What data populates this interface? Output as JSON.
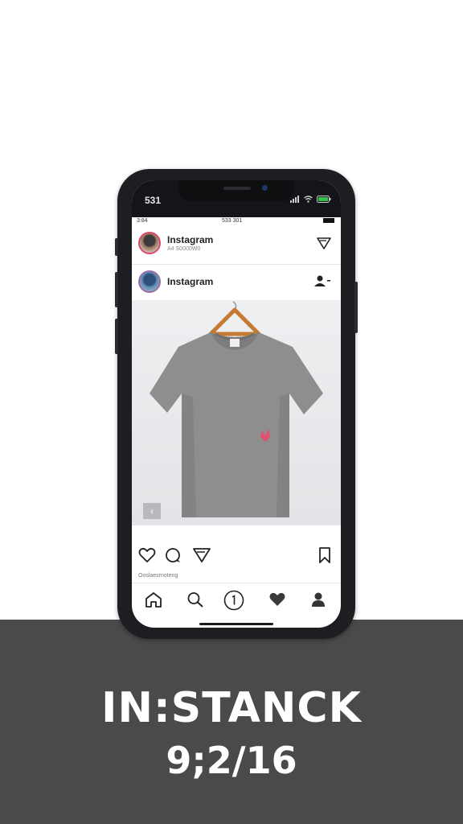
{
  "phone": {
    "status_time": "531",
    "mini_status_left": "3:84",
    "mini_status_mid": "533 301"
  },
  "account_row": {
    "name": "Instagram",
    "sub": "A4 S0000W0"
  },
  "post_header": {
    "name": "Instagram"
  },
  "post": {
    "caption": "Ooslaesrnoteng",
    "carousel_prev": "‹"
  },
  "overlay": {
    "title": "IN:STANCK",
    "subtitle": "9;2/16"
  },
  "icons": {
    "direct": "send-triangle-icon",
    "profile": "person-icon",
    "like": "heart-icon",
    "comment": "comment-bubble-icon",
    "share": "send-triangle-icon",
    "save": "bookmark-icon",
    "tab_home": "home-icon",
    "tab_search": "search-icon",
    "tab_center": "circle-1-icon",
    "tab_activity": "heart-filled-icon",
    "tab_profile": "person-icon"
  },
  "colors": {
    "avatar_ring": "#d94a6e",
    "tshirt": "#8e8e8e",
    "logo_mark": "#e05070",
    "hanger": "#d08840",
    "bottom_band": "#4a4a4a"
  }
}
